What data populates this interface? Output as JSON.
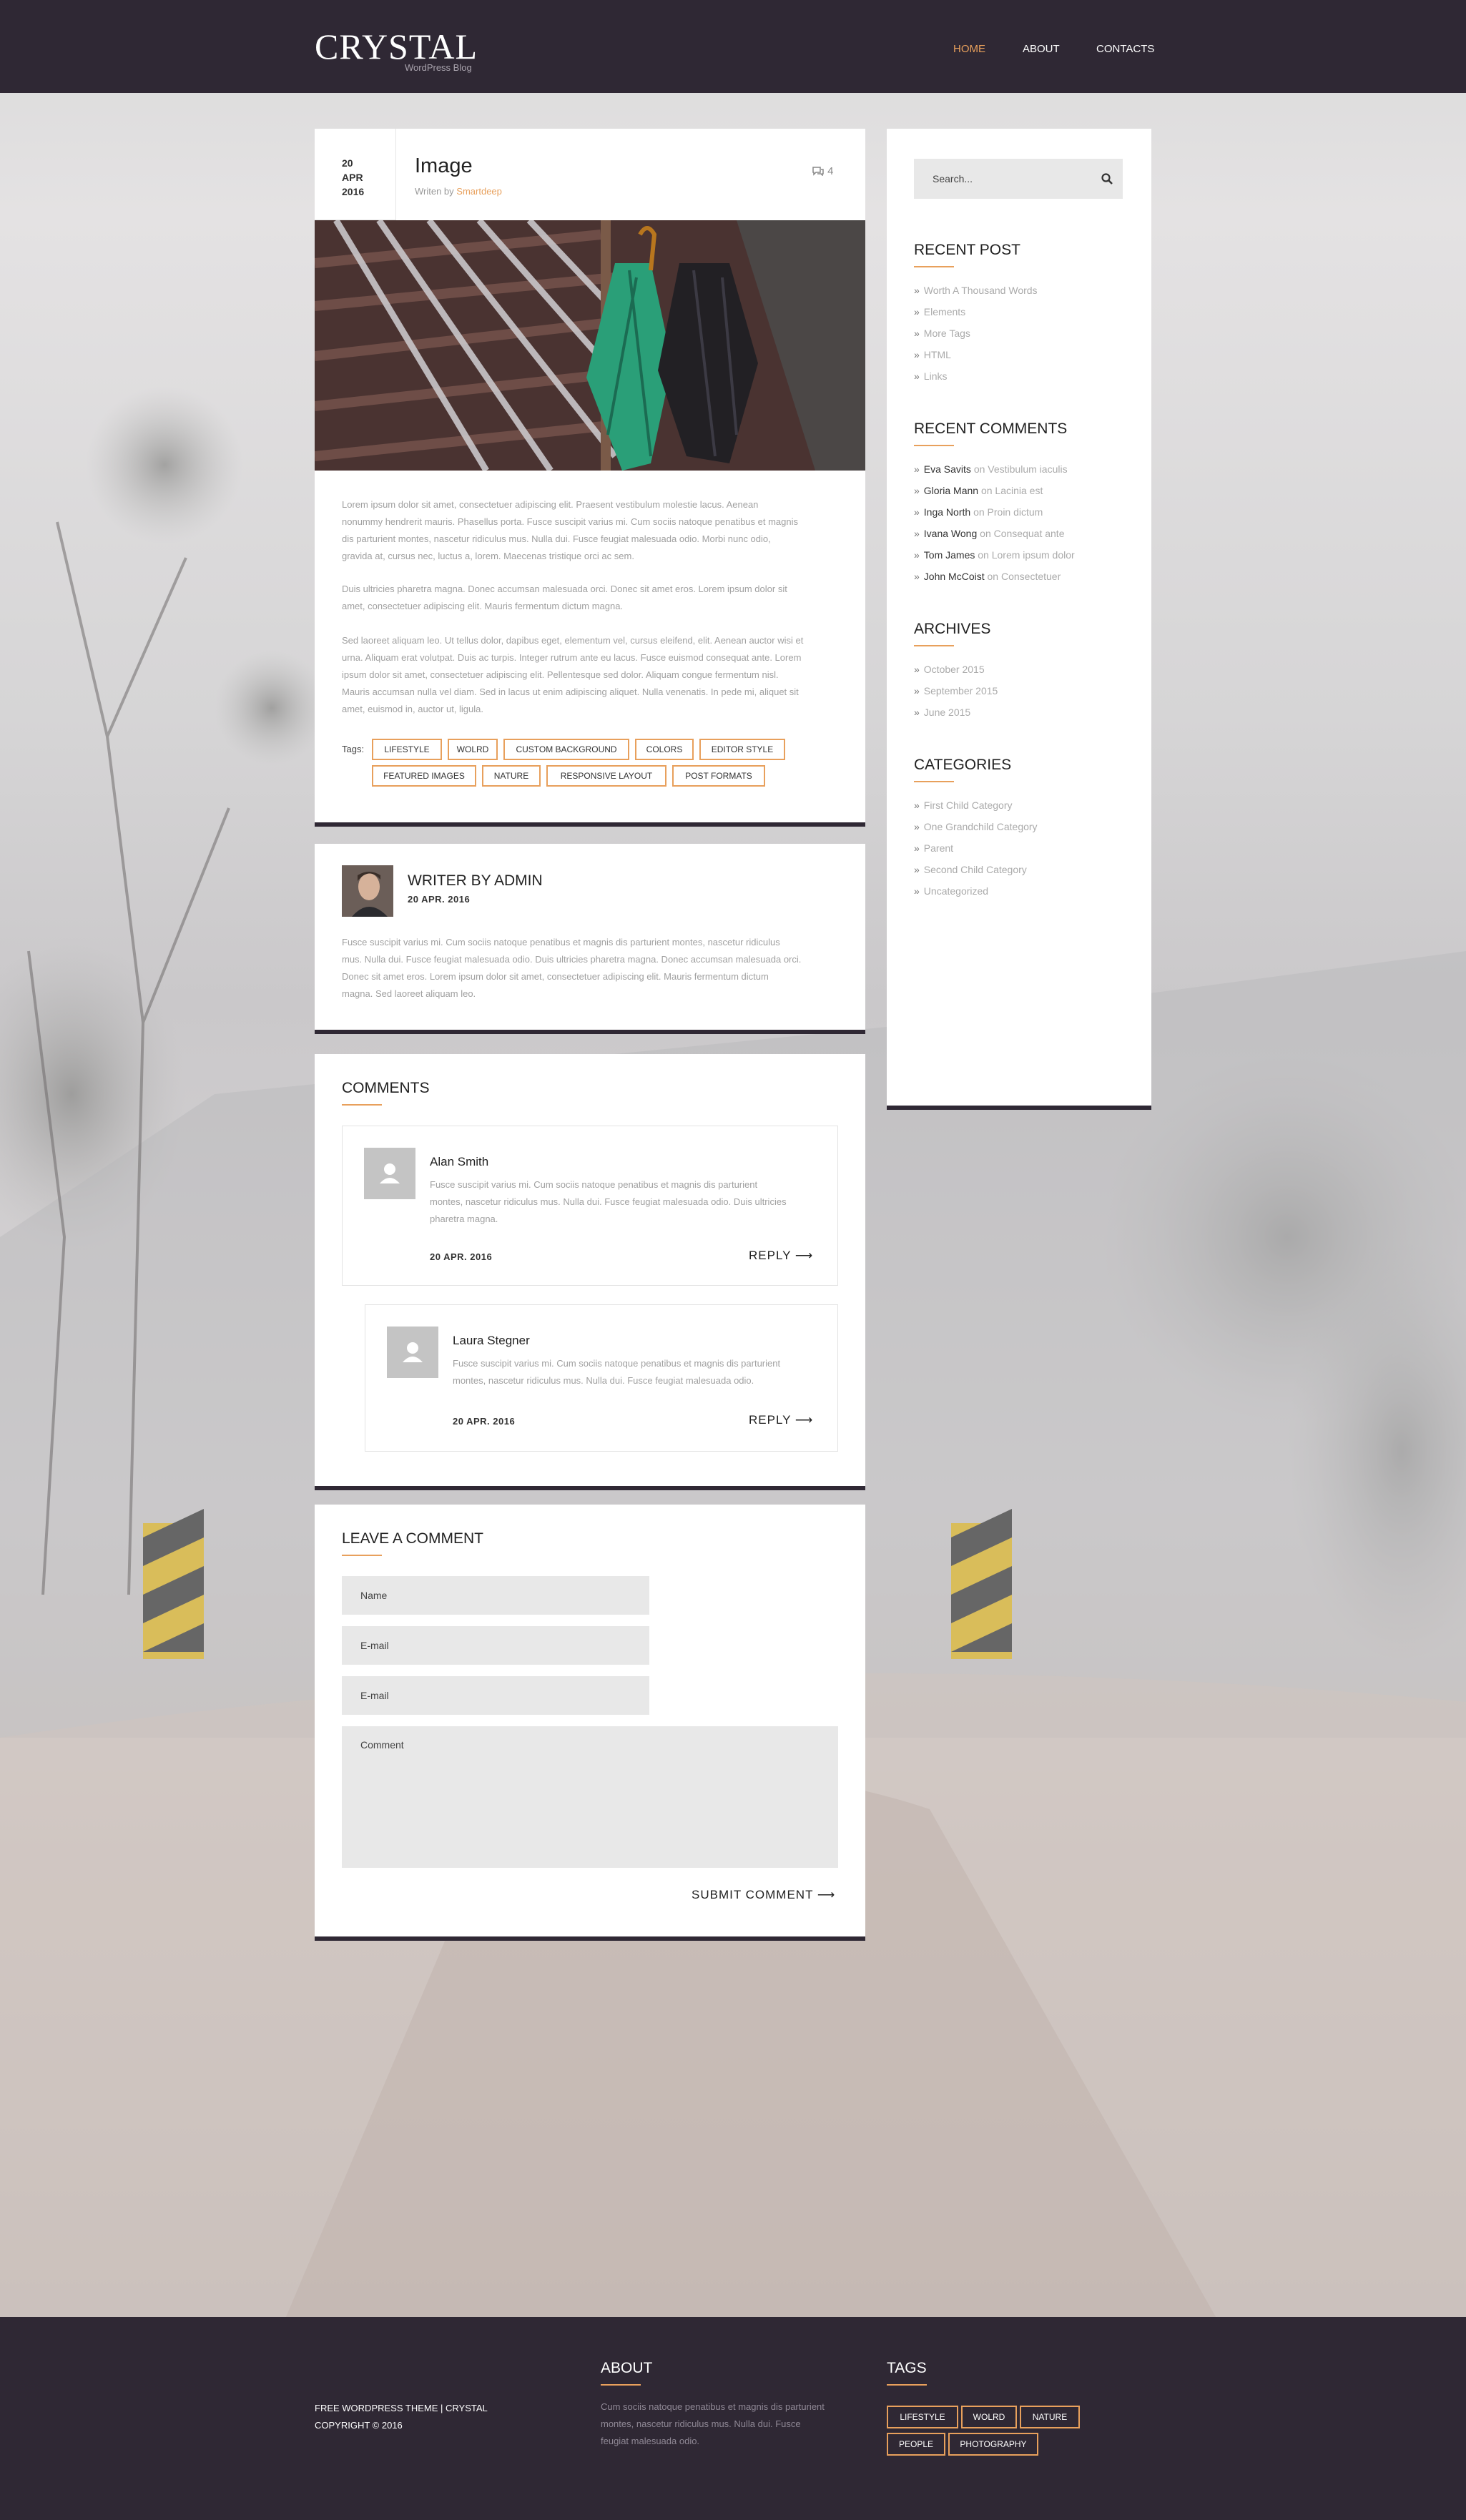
{
  "colors": {
    "accent": "#e8a05c",
    "dark": "#2f2834"
  },
  "header": {
    "logo": "CRYSTAL",
    "logo_sub": "WordPress Blog",
    "nav": [
      "HOME",
      "ABOUT",
      "CONTACTS"
    ]
  },
  "post": {
    "date_day": "20",
    "date_month": "APR",
    "date_year": "2016",
    "title": "Image",
    "written_prefix": "Writen by",
    "author": "Smartdeep",
    "comment_count": "4",
    "paragraphs": [
      [
        "Lorem ipsum dolor sit amet, consectetuer adipiscing elit. Praesent vestibulum molestie lacus. Aenean",
        "nonummy hendrerit mauris. Phasellus porta. Fusce suscipit varius mi. Cum sociis natoque penatibus et magnis",
        "dis parturient montes, nascetur ridiculus mus. Nulla dui. Fusce feugiat malesuada odio. Morbi nunc odio,",
        "gravida at, cursus nec, luctus a, lorem. Maecenas tristique orci ac sem."
      ],
      [
        "Duis ultricies pharetra magna. Donec accumsan malesuada orci. Donec sit amet eros. Lorem ipsum dolor sit",
        "amet, consectetuer adipiscing elit. Mauris fermentum dictum magna."
      ],
      [
        "Sed laoreet aliquam leo. Ut tellus dolor, dapibus eget, elementum vel, cursus eleifend, elit. Aenean auctor wisi et",
        "urna. Aliquam erat volutpat. Duis ac turpis. Integer rutrum ante eu lacus. Fusce euismod consequat ante. Lorem",
        "ipsum dolor sit amet, consectetuer adipiscing elit. Pellentesque sed dolor. Aliquam congue fermentum nisl.",
        "Mauris accumsan nulla vel diam. Sed in lacus ut enim adipiscing aliquet. Nulla venenatis. In pede mi, aliquet sit",
        "amet, euismod in, auctor ut, ligula."
      ]
    ],
    "tags_label": "Tags:",
    "tags": [
      "LIFESTYLE",
      "WOLRD",
      "CUSTOM BACKGROUND",
      "COLORS",
      "EDITOR STYLE",
      "FEATURED IMAGES",
      "NATURE",
      "RESPONSIVE LAYOUT",
      "POST FORMATS"
    ]
  },
  "author_box": {
    "title": "WRITER BY ADMIN",
    "date": "20 APR. 2016",
    "text": [
      "Fusce suscipit varius mi. Cum sociis natoque penatibus et magnis dis parturient montes, nascetur ridiculus",
      "mus. Nulla dui. Fusce feugiat malesuada odio. Duis ultricies pharetra magna. Donec accumsan malesuada orci.",
      "Donec sit amet eros. Lorem ipsum dolor sit amet, consectetuer adipiscing elit. Mauris fermentum dictum",
      "magna. Sed laoreet aliquam leo."
    ]
  },
  "comments": {
    "title": "COMMENTS",
    "reply_label": "REPLY",
    "items": [
      {
        "name": "Alan Smith",
        "text": [
          "Fusce suscipit varius mi. Cum sociis natoque penatibus et magnis dis parturient",
          "montes, nascetur ridiculus mus. Nulla dui. Fusce feugiat malesuada odio. Duis ultricies",
          "pharetra magna."
        ],
        "date": "20 APR. 2016"
      },
      {
        "name": "Laura Stegner",
        "text": [
          "Fusce suscipit varius mi. Cum sociis natoque penatibus et magnis dis parturient",
          "montes, nascetur ridiculus mus. Nulla dui. Fusce feugiat malesuada odio."
        ],
        "date": "20 APR. 2016"
      }
    ]
  },
  "leave": {
    "title": "LEAVE A COMMENT",
    "name_placeholder": "Name",
    "email_placeholder": "E-mail",
    "email2_placeholder": "E-mail",
    "comment_placeholder": "Comment",
    "submit": "SUBMIT COMMENT"
  },
  "sidebar": {
    "search_placeholder": "Search...",
    "recent_post_title": "RECENT POST",
    "recent_posts": [
      "Worth A Thousand Words",
      "Elements",
      "More Tags",
      "HTML",
      "Links"
    ],
    "recent_comments_title": "RECENT COMMENTS",
    "on": "on",
    "recent_comments": [
      {
        "author": "Eva Savits",
        "post": "Vestibulum iaculis"
      },
      {
        "author": "Gloria Mann",
        "post": "Lacinia est"
      },
      {
        "author": "Inga North",
        "post": "Proin dictum"
      },
      {
        "author": "Ivana Wong",
        "post": "Consequat ante"
      },
      {
        "author": "Tom James",
        "post": "Lorem ipsum dolor"
      },
      {
        "author": "John McCoist",
        "post": "Consectetuer"
      }
    ],
    "archives_title": "ARCHIVES",
    "archives": [
      "October 2015",
      "September 2015",
      "June 2015"
    ],
    "categories_title": "CATEGORIES",
    "categories": [
      "First Child Category",
      "One Grandchild Category",
      "Parent",
      "Second Child Category",
      "Uncategorized"
    ]
  },
  "footer": {
    "copy1": "FREE WORDPRESS THEME | CRYSTAL",
    "copy2": "COPYRIGHT © 2016",
    "about_title": "ABOUT",
    "about_text": [
      "Cum sociis natoque penatibus et magnis dis parturient",
      "montes, nascetur ridiculus mus. Nulla dui. Fusce",
      "feugiat malesuada odio."
    ],
    "tags_title": "TAGS",
    "tags": [
      "LIFESTYLE",
      "WOLRD",
      "NATURE",
      "PEOPLE",
      "PHOTOGRAPHY"
    ]
  }
}
